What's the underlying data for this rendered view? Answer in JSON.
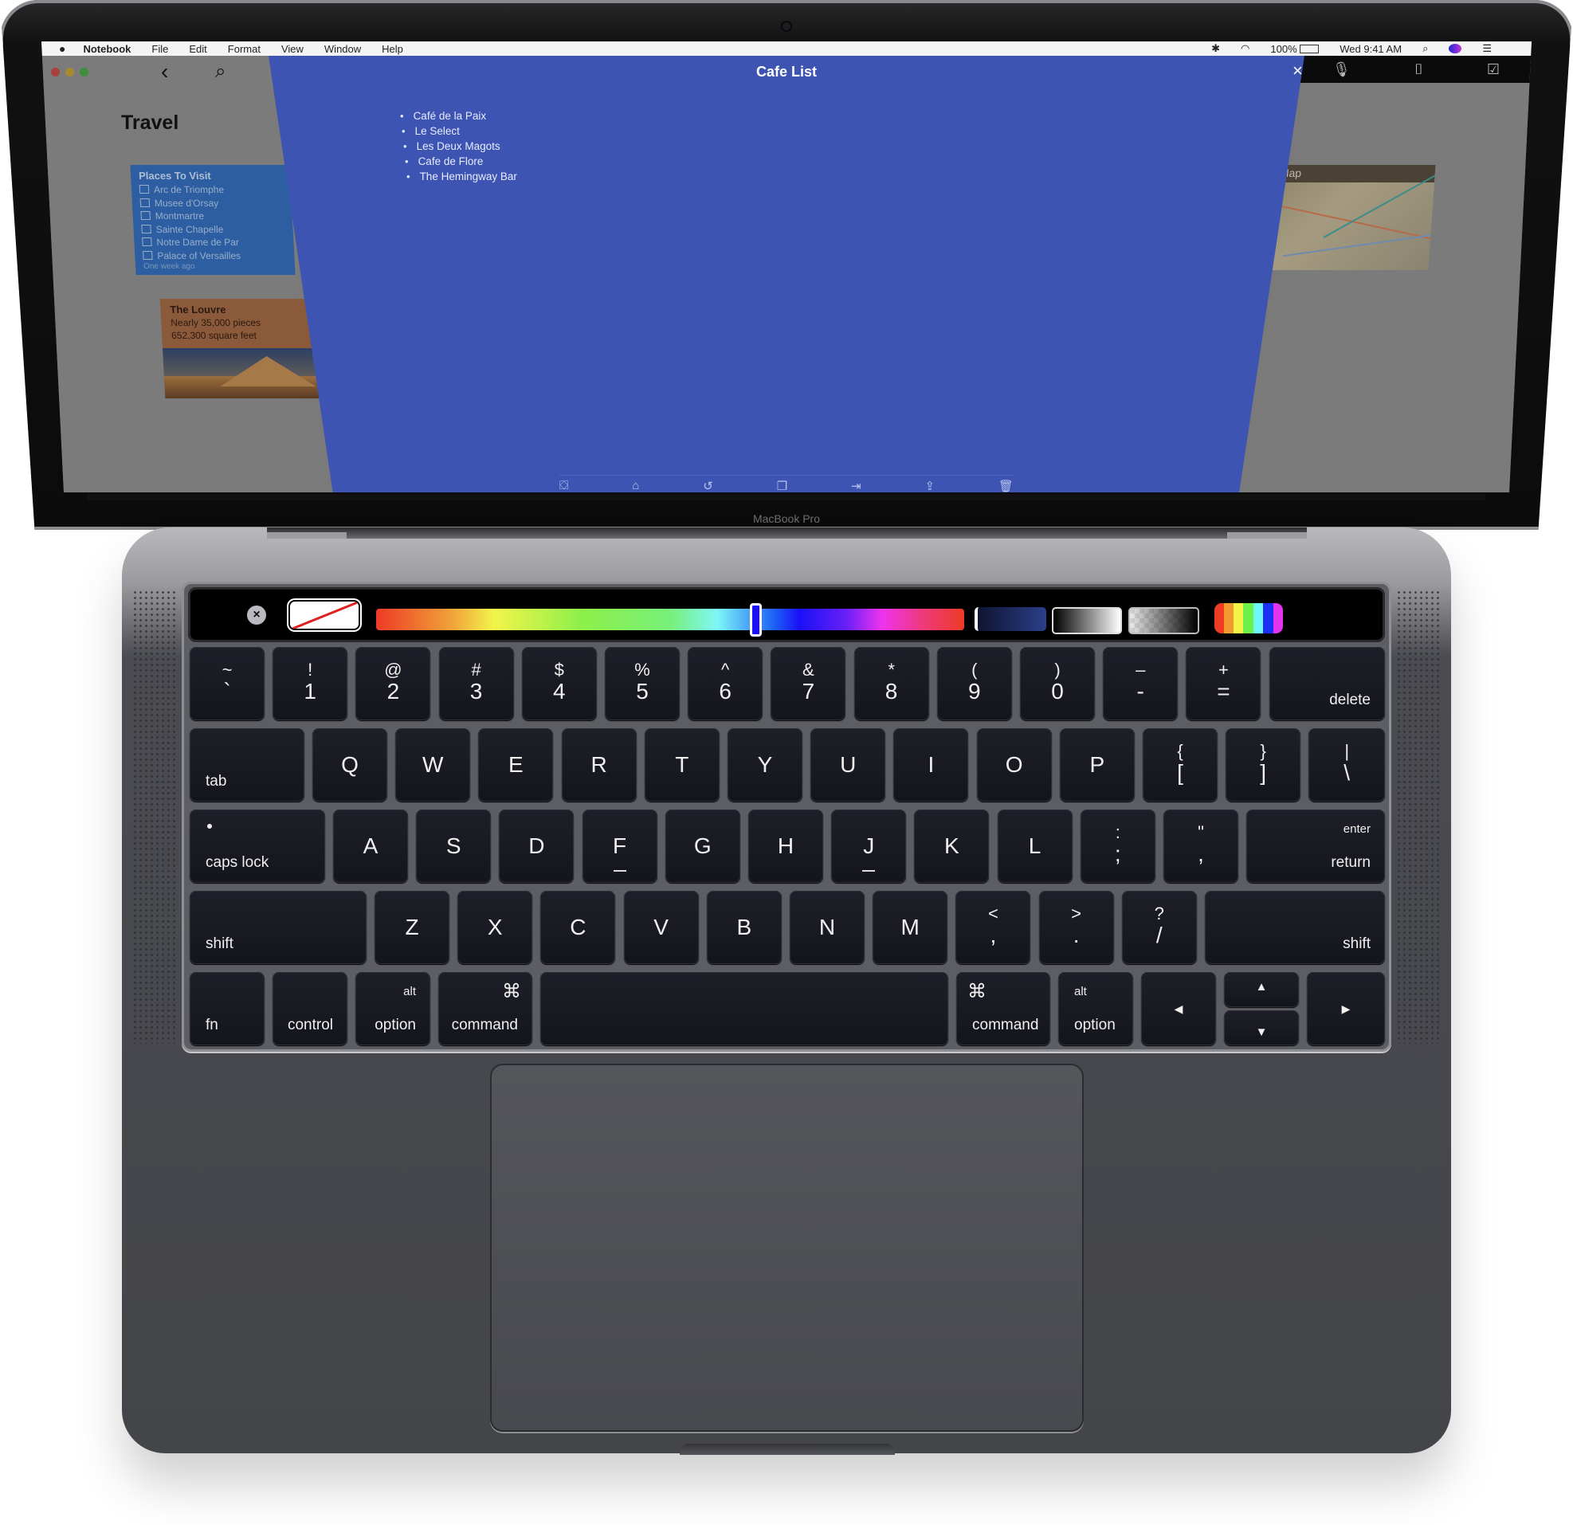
{
  "device": {
    "model_label": "MacBook Pro"
  },
  "menubar": {
    "apple_icon": "apple-logo-icon",
    "app_name": "Notebook",
    "menus": [
      "File",
      "Edit",
      "Format",
      "View",
      "Window",
      "Help"
    ],
    "status": {
      "bluetooth_icon": "bluetooth-icon",
      "wifi_icon": "wifi-icon",
      "battery": "100%",
      "datetime": "Wed 9:41 AM",
      "search_icon": "spotlight-icon",
      "siri_icon": "siri-icon",
      "list_icon": "notification-center-icon"
    }
  },
  "window": {
    "traffic_lights": {
      "close": "#ff5f57",
      "minimize": "#febc2e",
      "zoom": "#28c840"
    },
    "back_icon": "‹",
    "search_icon": "⌕",
    "toolbar_right": {
      "mic": "🎙",
      "camera": "📷",
      "check": "☑"
    }
  },
  "notebook": {
    "title": "Travel",
    "cards": {
      "places": {
        "title": "Places To Visit",
        "items": [
          "Arc de Triomphe",
          "Musee d'Orsay",
          "Montmartre",
          "Sainte Chapelle",
          "Notre Dame de Par",
          "Palace of Versailles"
        ],
        "timestamp": "One week ago"
      },
      "louvre": {
        "title": "The Louvre",
        "lines": [
          "Nearly 35,000 pieces",
          "652,300 square feet"
        ]
      },
      "map": {
        "title": "Map"
      }
    }
  },
  "note": {
    "title": "Cafe List",
    "close": "×",
    "items": [
      "Café de la Paix",
      "Le Select",
      "Les Deux Magots",
      "Cafe de Flore",
      "The Hemingway Bar"
    ],
    "toolbar": [
      "⛋",
      "⌂",
      "↺",
      "❐",
      "⇥",
      "⇪",
      "🗑"
    ],
    "background": "#3d54b2"
  },
  "touchbar": {
    "clear": "×",
    "selected_hue_fraction": 0.645,
    "swatches": [
      "no-color",
      "spectrum",
      "shade",
      "grayscale",
      "opacity",
      "palette"
    ]
  },
  "keyboard": {
    "row1": [
      {
        "top": "~",
        "bot": "`"
      },
      {
        "top": "!",
        "bot": "1"
      },
      {
        "top": "@",
        "bot": "2"
      },
      {
        "top": "#",
        "bot": "3"
      },
      {
        "top": "$",
        "bot": "4"
      },
      {
        "top": "%",
        "bot": "5"
      },
      {
        "top": "^",
        "bot": "6"
      },
      {
        "top": "&",
        "bot": "7"
      },
      {
        "top": "*",
        "bot": "8"
      },
      {
        "top": "(",
        "bot": "9"
      },
      {
        "top": ")",
        "bot": "0"
      },
      {
        "top": "–",
        "bot": "-"
      },
      {
        "top": "+",
        "bot": "="
      }
    ],
    "delete": "delete",
    "tab": "tab",
    "row2": [
      "Q",
      "W",
      "E",
      "R",
      "T",
      "Y",
      "U",
      "I",
      "O",
      "P"
    ],
    "row2_brackets": [
      {
        "top": "{",
        "bot": "["
      },
      {
        "top": "}",
        "bot": "]"
      },
      {
        "top": "|",
        "bot": "\\"
      }
    ],
    "caps": "caps lock",
    "row3": [
      "A",
      "S",
      "D",
      "F",
      "G",
      "H",
      "J",
      "K",
      "L"
    ],
    "row3_punct": [
      {
        "top": ":",
        "bot": ";"
      },
      {
        "top": "\"",
        "bot": ","
      }
    ],
    "enter": "enter",
    "return": "return",
    "shift": "shift",
    "row4": [
      "Z",
      "X",
      "C",
      "V",
      "B",
      "N",
      "M"
    ],
    "row4_punct": [
      {
        "top": "<",
        "bot": ","
      },
      {
        "top": ">",
        "bot": "."
      },
      {
        "top": "?",
        "bot": "/"
      }
    ],
    "fn": "fn",
    "control": "control",
    "alt": "alt",
    "option": "option",
    "command_symbol": "⌘",
    "command": "command",
    "arrows": {
      "left": "◀",
      "up": "▲",
      "down": "▼",
      "right": "▶"
    }
  }
}
